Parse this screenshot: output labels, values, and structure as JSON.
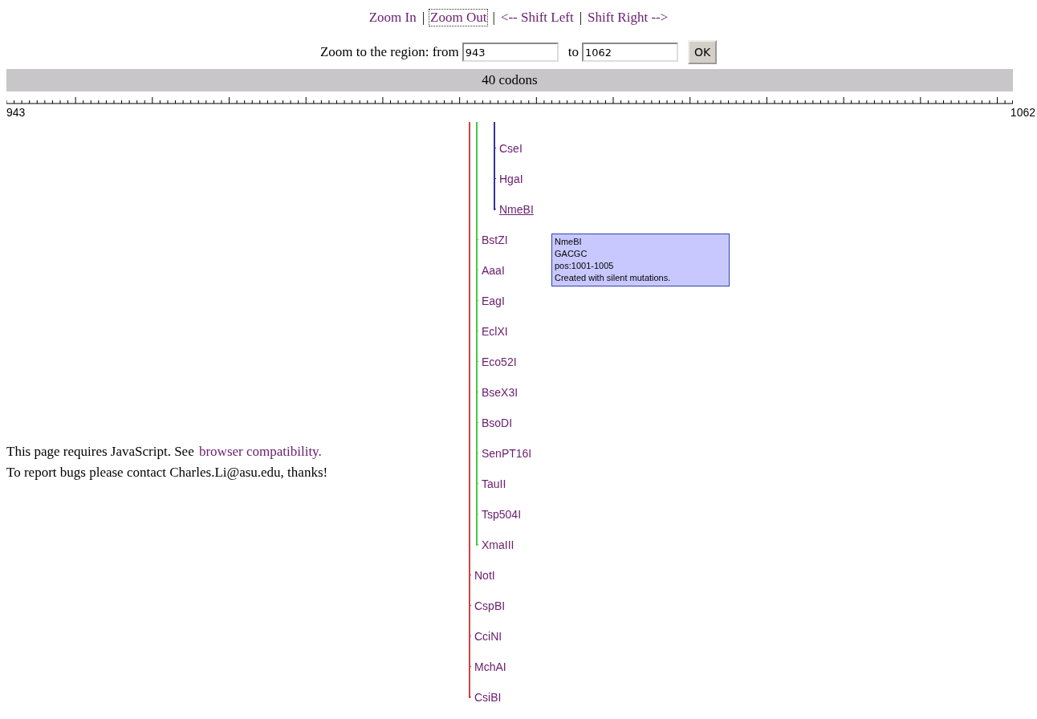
{
  "nav_links": [
    {
      "label": "Zoom In",
      "focused": false
    },
    {
      "label": "Zoom Out",
      "focused": true
    },
    {
      "label": "<-- Shift Left",
      "focused": false
    },
    {
      "label": "Shift Right -->",
      "focused": false
    }
  ],
  "nav_separator": "|",
  "region_form": {
    "label": "Zoom to the region: from",
    "from": "943",
    "to_label": "to",
    "to": "1062",
    "button": "OK"
  },
  "scale_bar": {
    "label": "40 codons"
  },
  "ruler": {
    "start": "943",
    "end": "1062"
  },
  "notes": [
    {
      "text": "This page requires JavaScript. See ",
      "link": "browser compatibility."
    },
    {
      "text": "To report bugs please contact Charles.Li@asu.edu, thanks!"
    }
  ],
  "enzyme_groups": [
    {
      "color": "#333399",
      "enzymes": [
        {
          "name": "CseI",
          "selected": false
        },
        {
          "name": "HgaI",
          "selected": false
        },
        {
          "name": "NmeBI",
          "selected": true
        }
      ]
    },
    {
      "color": "#44cc44",
      "enzymes": [
        {
          "name": "BstZI",
          "selected": false
        },
        {
          "name": "AaaI",
          "selected": false
        },
        {
          "name": "EagI",
          "selected": false
        },
        {
          "name": "EclXI",
          "selected": false
        },
        {
          "name": "Eco52I",
          "selected": false
        },
        {
          "name": "BseX3I",
          "selected": false
        },
        {
          "name": "BsoDI",
          "selected": false
        },
        {
          "name": "SenPT16I",
          "selected": false
        },
        {
          "name": "TauII",
          "selected": false
        },
        {
          "name": "Tsp504I",
          "selected": false
        },
        {
          "name": "XmaIII",
          "selected": false
        }
      ]
    },
    {
      "color": "#cc4444",
      "enzymes": [
        {
          "name": "NotI",
          "selected": false
        },
        {
          "name": "CspBI",
          "selected": false
        },
        {
          "name": "CciNI",
          "selected": false
        },
        {
          "name": "MchAI",
          "selected": false
        },
        {
          "name": "CsiBI",
          "selected": false
        }
      ]
    }
  ],
  "tooltip": {
    "lines": [
      "NmeBI",
      "GACGC",
      "pos:1001-1005",
      "Created with silent mutations."
    ]
  }
}
